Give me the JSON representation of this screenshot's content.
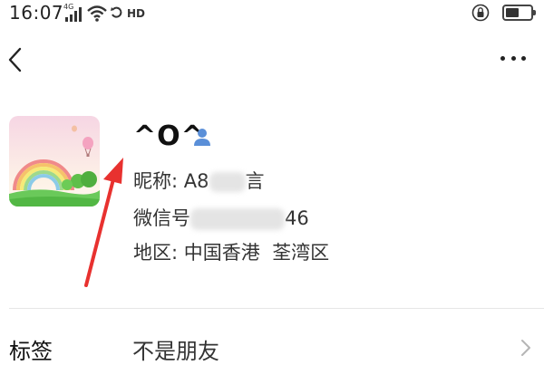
{
  "status_bar": {
    "time": "16:07",
    "network_label": "4G",
    "hd_label": "HD",
    "battery_level": 0.55
  },
  "nav": {
    "back_icon": "chevron-left-icon",
    "more_icon": "more-dots-icon"
  },
  "profile": {
    "display_name": "^O^",
    "nickname_label": "昵称: ",
    "nickname_visible_prefix": "A8",
    "nickname_visible_suffix": "言",
    "wechat_id_label": "微信号",
    "wechat_id_visible_suffix": "46",
    "region_label": "地区: ",
    "region_value": "中国香港  荃湾区"
  },
  "tag_row": {
    "label": "标签",
    "value": "不是朋友"
  },
  "colors": {
    "annotation_arrow": "#e8312f",
    "person_icon": "#5a8fd8"
  }
}
